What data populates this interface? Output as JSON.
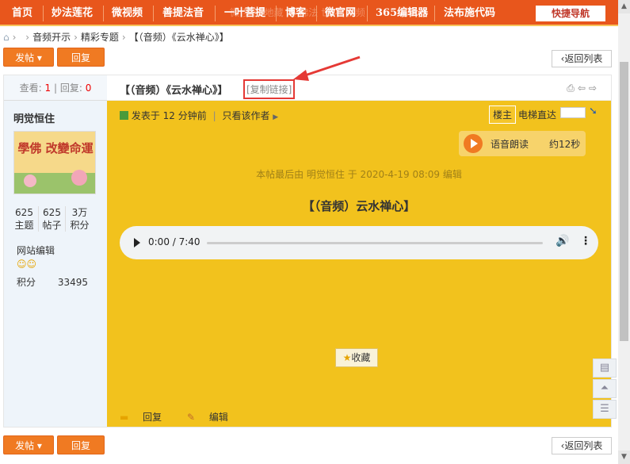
{
  "topnav": {
    "items": [
      "首页",
      "妙法莲花",
      "微视频",
      "善提法音",
      "一叶菩提",
      "博客",
      "微官网",
      "365编辑器",
      "法布施代码"
    ],
    "quick_nav": "快捷导航",
    "marquee": "微 梦谷 地藏 法 佛法 世 听 视频"
  },
  "breadcrumb": {
    "items": [
      "音频开示",
      "精彩专题",
      "【（音频）《云水禅心》】"
    ]
  },
  "toolbar": {
    "post_btn": "发帖",
    "post_arrow": "▾",
    "reply_btn": "回复",
    "back_btn": "返回列表"
  },
  "sidebar": {
    "views_label": "查看:",
    "views": "1",
    "replies_label": "回复:",
    "replies": "0",
    "author": "明觉恒住",
    "avatar_text": "學佛 改變命運",
    "stats": [
      {
        "value": "625",
        "label": "主题"
      },
      {
        "value": "625",
        "label": "帖子"
      },
      {
        "value": "3万",
        "label": "积分"
      }
    ],
    "role": "网站编辑",
    "credits_label": "积分",
    "credits_value": "33495"
  },
  "post": {
    "title": "【（音频）《云水禅心》】",
    "copy_link": "[复制链接]",
    "meta_posted": "发表于 12 分钟前",
    "meta_only_author": "只看该作者",
    "floor": "楼主",
    "elevator": "电梯直达",
    "tts_label": "语音朗读",
    "tts_time": "约12秒",
    "edited": "本帖最后由 明觉恒住 于 2020-4-19 08:09 编辑",
    "headline": "【（音频）云水禅心】",
    "audio_time": "0:00 / 7:40",
    "favorite": "收藏",
    "footer_reply": "回复",
    "footer_edit": "编辑"
  },
  "colors": {
    "nav_bg": "#e8561c",
    "post_bg": "#f2c21d",
    "accent": "#f07a22",
    "highlight": "#e53935"
  }
}
